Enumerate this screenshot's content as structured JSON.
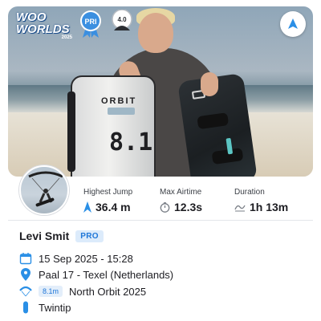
{
  "hero": {
    "event_badge": {
      "line1": "WOO",
      "line2": "WORLDS",
      "year": "2025"
    },
    "pro_badge_label": "PRI",
    "rating_value": "4.0",
    "kite_bag_brand": "ORBIT",
    "kite_bag_size": "8.1",
    "share_icon": "share-arrow-icon"
  },
  "stats": [
    {
      "label": "Highest Jump",
      "value": "36.4 m",
      "icon": "jump-arrow-icon"
    },
    {
      "label": "Max Airtime",
      "value": "12.3s",
      "icon": "stopwatch-icon"
    },
    {
      "label": "Duration",
      "value": "1h 13m",
      "icon": "wave-icon"
    }
  ],
  "rider": {
    "name": "Levi Smit",
    "tag": "PRO"
  },
  "details": {
    "date": "15 Sep 2025 - 15:28",
    "location": "Paal 17 - Texel (Netherlands)",
    "kite_size": "8.1m",
    "kite_name": "North Orbit 2025",
    "board": "Twintip"
  },
  "colors": {
    "accent": "#1f77d8",
    "accent_bg": "#dcebfb",
    "text": "#1d1d22"
  }
}
